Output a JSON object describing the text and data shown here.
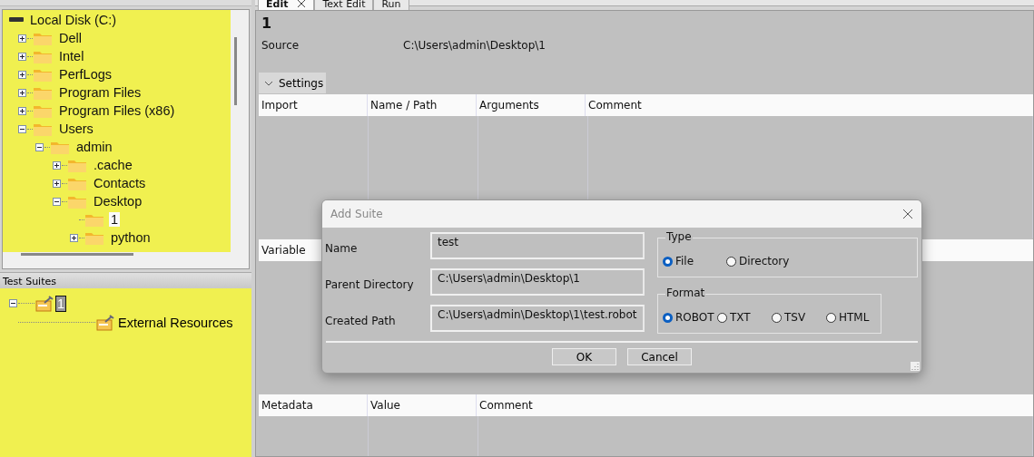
{
  "file_tree": {
    "root": {
      "label": "Local Disk (C:)",
      "children": [
        {
          "label": "Dell",
          "expandable": true,
          "expanded": false,
          "selected": false
        },
        {
          "label": "Intel",
          "expandable": true,
          "expanded": false,
          "selected": false
        },
        {
          "label": "PerfLogs",
          "expandable": true,
          "expanded": false,
          "selected": false
        },
        {
          "label": "Program Files",
          "expandable": true,
          "expanded": false,
          "selected": false
        },
        {
          "label": "Program Files (x86)",
          "expandable": true,
          "expanded": false,
          "selected": false
        },
        {
          "label": "Users",
          "expandable": true,
          "expanded": true,
          "selected": false,
          "children": [
            {
              "label": "admin",
              "expandable": true,
              "expanded": true,
              "selected": false,
              "children": [
                {
                  "label": ".cache",
                  "expandable": true,
                  "expanded": false,
                  "selected": false
                },
                {
                  "label": "Contacts",
                  "expandable": true,
                  "expanded": false,
                  "selected": false
                },
                {
                  "label": "Desktop",
                  "expandable": true,
                  "expanded": true,
                  "selected": false,
                  "children": [
                    {
                      "label": "1",
                      "expandable": false,
                      "selected": true
                    },
                    {
                      "label": "python",
                      "expandable": true,
                      "expanded": false,
                      "selected": false
                    }
                  ]
                }
              ]
            }
          ]
        }
      ]
    }
  },
  "test_suites": {
    "title": "Test Suites",
    "items": [
      {
        "label": "1",
        "expanded": true,
        "selected": true
      },
      {
        "label": "External Resources",
        "selected": false
      }
    ]
  },
  "tabs": [
    {
      "label": "Edit",
      "selected": true,
      "closable": true
    },
    {
      "label": "Text Edit",
      "selected": false,
      "closable": false
    },
    {
      "label": "Run",
      "selected": false,
      "closable": false
    }
  ],
  "editor": {
    "title": "1",
    "source_label": "Source",
    "source_value": "C:\\Users\\admin\\Desktop\\1",
    "settings_label": "Settings",
    "settings_expanded": false,
    "import_columns": [
      "Import",
      "Name / Path",
      "Arguments",
      "Comment"
    ],
    "variable_columns": [
      "Variable"
    ],
    "metadata_columns": [
      "Metadata",
      "Value",
      "Comment"
    ]
  },
  "dialog": {
    "title": "Add Suite",
    "fields": [
      {
        "label": "Name",
        "value": "test"
      },
      {
        "label": "Parent Directory",
        "value": "C:\\Users\\admin\\Desktop\\1"
      },
      {
        "label": "Created Path",
        "value": "C:\\Users\\admin\\Desktop\\1\\test.robot"
      }
    ],
    "type_group": {
      "title": "Type",
      "options": [
        {
          "label": "File",
          "selected": true
        },
        {
          "label": "Directory",
          "selected": false
        }
      ]
    },
    "format_group": {
      "title": "Format",
      "options": [
        {
          "label": "ROBOT",
          "selected": true
        },
        {
          "label": "TXT",
          "selected": false
        },
        {
          "label": "TSV",
          "selected": false
        },
        {
          "label": "HTML",
          "selected": false
        }
      ]
    },
    "buttons": [
      "OK",
      "Cancel"
    ]
  }
}
